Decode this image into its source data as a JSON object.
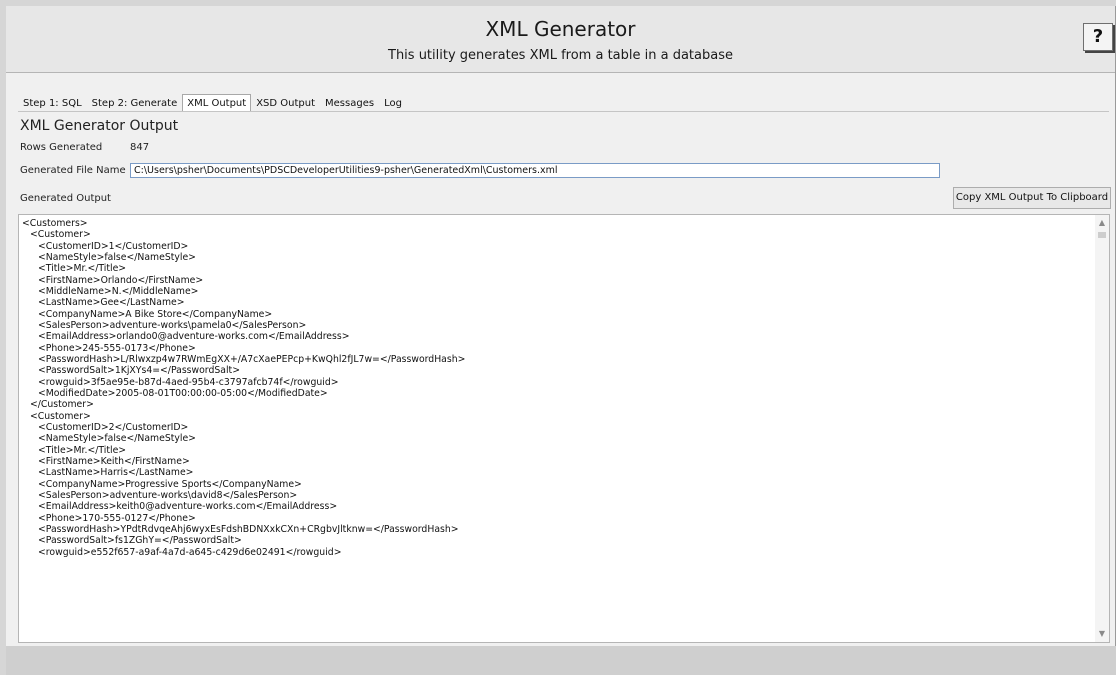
{
  "header": {
    "title": "XML Generator",
    "subtitle": "This utility generates XML from a table in a database",
    "help_label": "?"
  },
  "tabs": [
    {
      "label": "Step 1: SQL",
      "active": false
    },
    {
      "label": "Step 2: Generate",
      "active": false
    },
    {
      "label": "XML Output",
      "active": true
    },
    {
      "label": "XSD Output",
      "active": false
    },
    {
      "label": "Messages",
      "active": false
    },
    {
      "label": "Log",
      "active": false
    }
  ],
  "output": {
    "section_title": "XML Generator Output",
    "rows_label": "Rows Generated",
    "rows_value": "847",
    "file_label": "Generated File Name",
    "file_value": "C:\\Users\\psher\\Documents\\PDSCDeveloperUtilities9-psher\\GeneratedXml\\Customers.xml",
    "generated_label": "Generated Output",
    "copy_button": "Copy XML Output To Clipboard"
  },
  "xml_lines": [
    {
      "indent": 0,
      "text": "<Customers>"
    },
    {
      "indent": 1,
      "text": "<Customer>"
    },
    {
      "indent": 2,
      "text": "<CustomerID>1</CustomerID>"
    },
    {
      "indent": 2,
      "text": "<NameStyle>false</NameStyle>"
    },
    {
      "indent": 2,
      "text": "<Title>Mr.</Title>"
    },
    {
      "indent": 2,
      "text": "<FirstName>Orlando</FirstName>"
    },
    {
      "indent": 2,
      "text": "<MiddleName>N.</MiddleName>"
    },
    {
      "indent": 2,
      "text": "<LastName>Gee</LastName>"
    },
    {
      "indent": 2,
      "text": "<CompanyName>A Bike Store</CompanyName>"
    },
    {
      "indent": 2,
      "text": "<SalesPerson>adventure-works\\pamela0</SalesPerson>"
    },
    {
      "indent": 2,
      "text": "<EmailAddress>orlando0@adventure-works.com</EmailAddress>"
    },
    {
      "indent": 2,
      "text": "<Phone>245-555-0173</Phone>"
    },
    {
      "indent": 2,
      "text": "<PasswordHash>L/Rlwxzp4w7RWmEgXX+/A7cXaePEPcp+KwQhl2fJL7w=</PasswordHash>"
    },
    {
      "indent": 2,
      "text": "<PasswordSalt>1KjXYs4=</PasswordSalt>"
    },
    {
      "indent": 2,
      "text": "<rowguid>3f5ae95e-b87d-4aed-95b4-c3797afcb74f</rowguid>"
    },
    {
      "indent": 2,
      "text": "<ModifiedDate>2005-08-01T00:00:00-05:00</ModifiedDate>"
    },
    {
      "indent": 1,
      "text": "</Customer>"
    },
    {
      "indent": 1,
      "text": "<Customer>"
    },
    {
      "indent": 2,
      "text": "<CustomerID>2</CustomerID>"
    },
    {
      "indent": 2,
      "text": "<NameStyle>false</NameStyle>"
    },
    {
      "indent": 2,
      "text": "<Title>Mr.</Title>"
    },
    {
      "indent": 2,
      "text": "<FirstName>Keith</FirstName>"
    },
    {
      "indent": 2,
      "text": "<LastName>Harris</LastName>"
    },
    {
      "indent": 2,
      "text": "<CompanyName>Progressive Sports</CompanyName>"
    },
    {
      "indent": 2,
      "text": "<SalesPerson>adventure-works\\david8</SalesPerson>"
    },
    {
      "indent": 2,
      "text": "<EmailAddress>keith0@adventure-works.com</EmailAddress>"
    },
    {
      "indent": 2,
      "text": "<Phone>170-555-0127</Phone>"
    },
    {
      "indent": 2,
      "text": "<PasswordHash>YPdtRdvqeAhj6wyxEsFdshBDNXxkCXn+CRgbvJltknw=</PasswordHash>"
    },
    {
      "indent": 2,
      "text": "<PasswordSalt>fs1ZGhY=</PasswordSalt>"
    },
    {
      "indent": 2,
      "text": "<rowguid>e552f657-a9af-4a7d-a645-c429d6e02491</rowguid>"
    }
  ],
  "scrollbar": {
    "up_icon": "chevron-up-icon",
    "down_icon": "chevron-down-icon"
  },
  "colors": {
    "window_bg": "#f0f0f0",
    "header_bg": "#e7e7e7",
    "input_border": "#7a9bc6"
  }
}
